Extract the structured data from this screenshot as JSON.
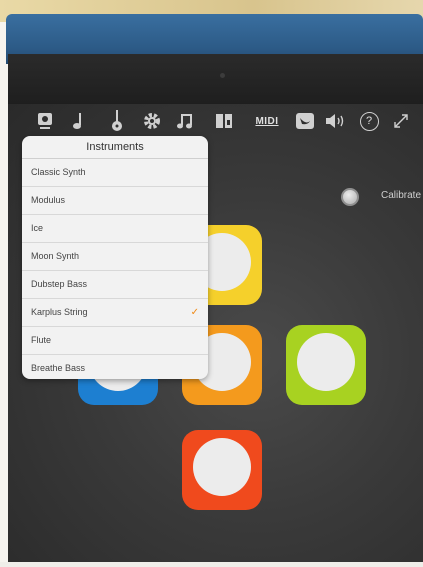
{
  "toolbar": {
    "items": [
      {
        "name": "scene-icon"
      },
      {
        "name": "note-icon"
      },
      {
        "name": "guitar-icon"
      },
      {
        "name": "gear-icon"
      },
      {
        "name": "double-note-icon"
      },
      {
        "name": "sound-file-icon"
      },
      {
        "name": "midi-icon",
        "label": "MIDI"
      },
      {
        "name": "swift-icon"
      },
      {
        "name": "speaker-icon"
      },
      {
        "name": "help-icon",
        "label": "?"
      },
      {
        "name": "expand-icon"
      }
    ]
  },
  "calibrate": {
    "label": "Calibrate"
  },
  "instruments_menu": {
    "title": "Instruments",
    "items": [
      {
        "label": "Classic Synth",
        "selected": false
      },
      {
        "label": "Modulus",
        "selected": false
      },
      {
        "label": "Ice",
        "selected": false
      },
      {
        "label": "Moon Synth",
        "selected": false
      },
      {
        "label": "Dubstep Bass",
        "selected": false
      },
      {
        "label": "Karplus String",
        "selected": true,
        "check": "✓"
      },
      {
        "label": "Flute",
        "selected": false
      },
      {
        "label": "Breathe Bass",
        "selected": false
      }
    ]
  },
  "pads": {
    "colors": {
      "yellow": "#f5d02b",
      "blue": "#1d7fd1",
      "orange": "#f49a1d",
      "green": "#a8d221",
      "red": "#f04a1d"
    }
  },
  "accent": "#f08a16"
}
